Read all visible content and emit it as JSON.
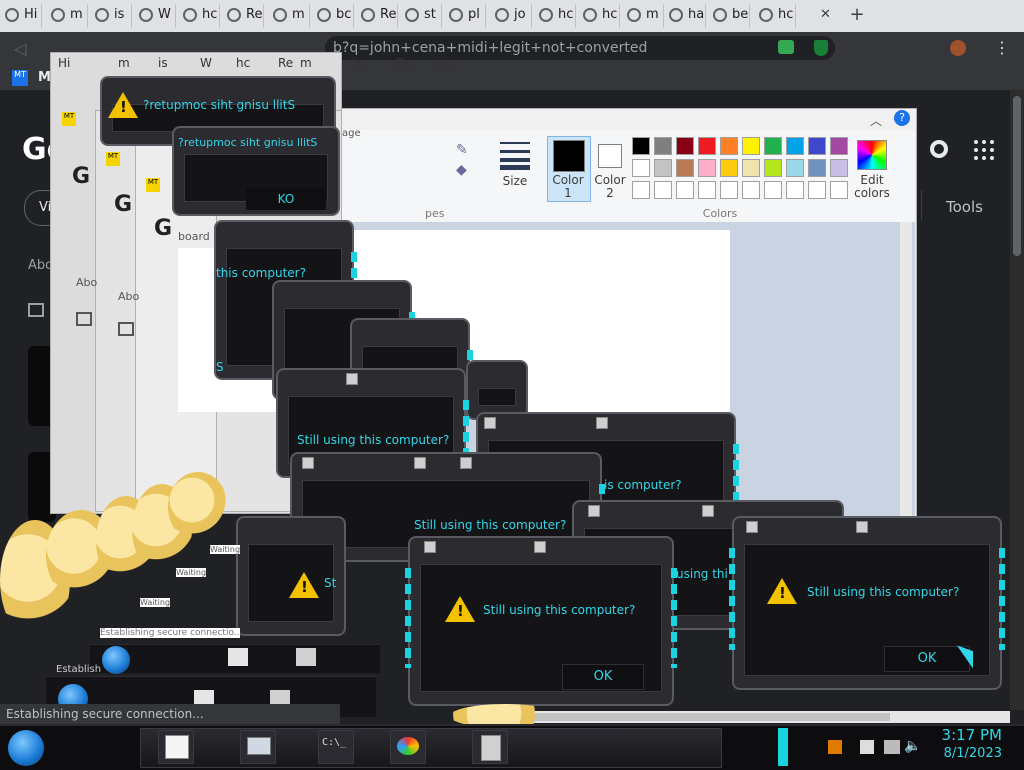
{
  "browser": {
    "tabs": [
      {
        "label": "Hi"
      },
      {
        "label": "m"
      },
      {
        "label": "is"
      },
      {
        "label": "W"
      },
      {
        "label": "hc"
      },
      {
        "label": "Re"
      },
      {
        "label": "m"
      },
      {
        "label": "bc"
      },
      {
        "label": "Re"
      },
      {
        "label": "st"
      },
      {
        "label": "pl"
      },
      {
        "label": "jo"
      },
      {
        "label": "hc"
      },
      {
        "label": "hc"
      },
      {
        "label": "m"
      },
      {
        "label": "ha"
      },
      {
        "label": "be"
      },
      {
        "label": "hc"
      }
    ],
    "close_glyph": "✕",
    "new_tab_glyph": "+",
    "url": "b?q=john+cena+midi+legit+not+converted",
    "bookmark_label": "M",
    "status_text": "Establishing secure connection..."
  },
  "google": {
    "logo": "Go",
    "tools_label": "Tools",
    "about_label": "Abo",
    "vi_label": "Vi"
  },
  "paint": {
    "size_label": "Size",
    "color1_label": "Color\n1",
    "color2_label": "Color\n2",
    "colors_group": "Colors",
    "edit_colors_label": "Edit\ncolors",
    "shapes_label": "pes",
    "board_label": "board",
    "image_label": "age",
    "palette_row1": [
      "#000000",
      "#7f7f7f",
      "#880015",
      "#ed1c24",
      "#ff7f27",
      "#fff200",
      "#22b14c",
      "#00a2e8",
      "#3f48cc",
      "#a349a4"
    ],
    "palette_row2": [
      "#ffffff",
      "#c3c3c3",
      "#b97a57",
      "#ffaec9",
      "#ffc90e",
      "#efe4b0",
      "#b5e61d",
      "#99d9ea",
      "#7092be",
      "#c8bfe7"
    ],
    "palette_row3": [
      "#ffffff",
      "#ffffff",
      "#ffffff",
      "#ffffff",
      "#ffffff",
      "#ffffff",
      "#ffffff",
      "#ffffff",
      "#ffffff",
      "#ffffff"
    ]
  },
  "dialogs": {
    "message": "Still using this computer?",
    "message_mirrored": "?retupmoc siht gnisu llitS",
    "ok_label": "OK",
    "ok_mirrored": "KO",
    "partial_using": "using thi",
    "partial_is": "is computer?",
    "partial_ok": "K",
    "partial_s": "S",
    "partial_st": "St"
  },
  "mini_windows": {
    "tab_hi": "Hi",
    "tab_m": "m",
    "tab_is": "is",
    "tab_w": "W",
    "tab_hc": "hc",
    "tab_re": "Re",
    "tab_bc": "bc",
    "tab_st": "sta",
    "waiting": "Waiting",
    "establishing": "Establishing secure connectio..."
  },
  "taskbar": {
    "time": "3:17 PM",
    "date": "8/1/2023",
    "cmd_label": "C:\\_"
  },
  "colors": {
    "accent_cyan": "#33d6e8",
    "warning_yellow": "#f2c200",
    "dialog_body": "#141416"
  }
}
